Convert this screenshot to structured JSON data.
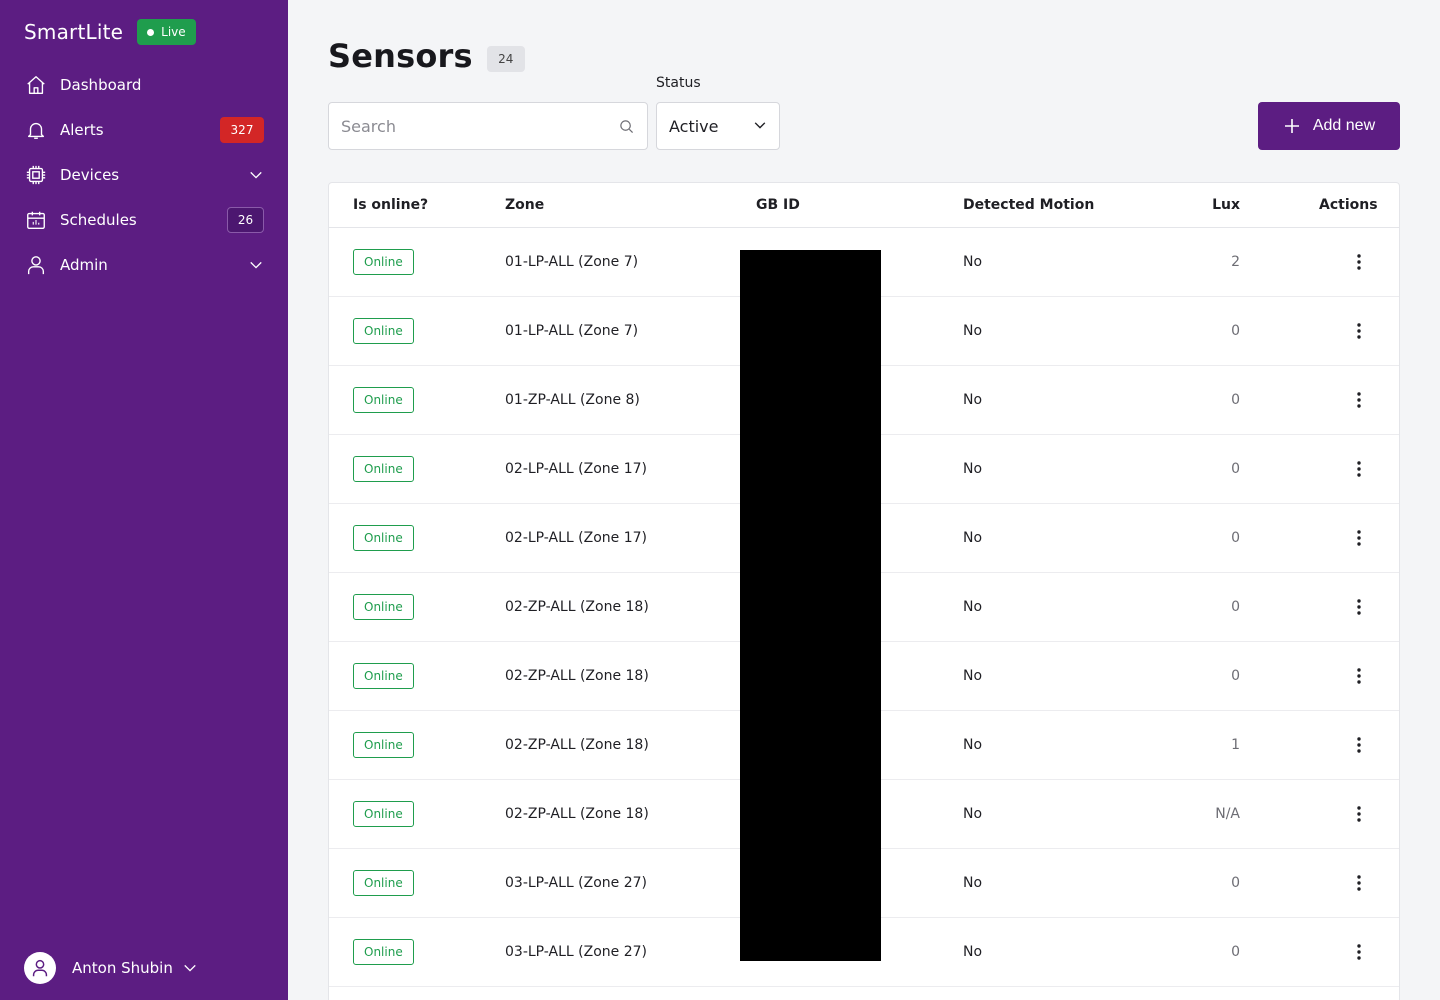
{
  "app": {
    "name": "SmartLite",
    "env_badge": "Live",
    "accent": "#5c1d82",
    "live_color": "#1f9d4d"
  },
  "sidebar": {
    "items": [
      {
        "label": "Dashboard",
        "icon": "home-icon"
      },
      {
        "label": "Alerts",
        "icon": "bell-icon",
        "count": "327"
      },
      {
        "label": "Devices",
        "icon": "chip-icon"
      },
      {
        "label": "Schedules",
        "icon": "calendar-icon",
        "count": "26"
      },
      {
        "label": "Admin",
        "icon": "person-icon"
      }
    ],
    "user": {
      "name": "Anton Shubin"
    }
  },
  "header": {
    "title": "Sensors",
    "count": "24"
  },
  "filters": {
    "search_placeholder": "Search",
    "status_label": "Status",
    "status_value": "Active"
  },
  "toolbar": {
    "add_label": "Add new"
  },
  "table": {
    "columns": [
      "Is online?",
      "Zone",
      "GB ID",
      "Detected Motion",
      "Lux",
      "Actions"
    ],
    "rows": [
      {
        "online": "Online",
        "zone": "01-LP-ALL (Zone 7)",
        "motion": "No",
        "lux": "2"
      },
      {
        "online": "Online",
        "zone": "01-LP-ALL (Zone 7)",
        "motion": "No",
        "lux": "0"
      },
      {
        "online": "Online",
        "zone": "01-ZP-ALL (Zone 8)",
        "motion": "No",
        "lux": "0"
      },
      {
        "online": "Online",
        "zone": "02-LP-ALL (Zone 17)",
        "motion": "No",
        "lux": "0"
      },
      {
        "online": "Online",
        "zone": "02-LP-ALL (Zone 17)",
        "motion": "No",
        "lux": "0"
      },
      {
        "online": "Online",
        "zone": "02-ZP-ALL (Zone 18)",
        "motion": "No",
        "lux": "0"
      },
      {
        "online": "Online",
        "zone": "02-ZP-ALL (Zone 18)",
        "motion": "No",
        "lux": "0"
      },
      {
        "online": "Online",
        "zone": "02-ZP-ALL (Zone 18)",
        "motion": "No",
        "lux": "1"
      },
      {
        "online": "Online",
        "zone": "02-ZP-ALL (Zone 18)",
        "motion": "No",
        "lux": "N/A"
      },
      {
        "online": "Online",
        "zone": "03-LP-ALL (Zone 27)",
        "motion": "No",
        "lux": "0"
      },
      {
        "online": "Online",
        "zone": "03-LP-ALL (Zone 27)",
        "motion": "No",
        "lux": "0"
      }
    ]
  }
}
